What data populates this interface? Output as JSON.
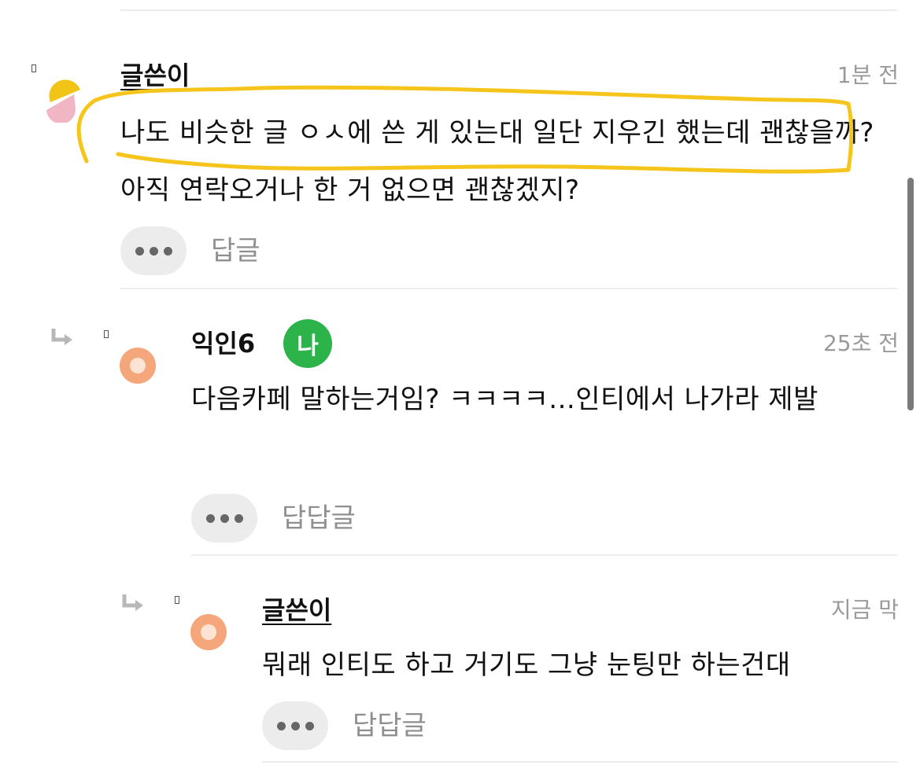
{
  "comments": [
    {
      "author": "글쓴이",
      "time": "1분 전",
      "text": "나도 비슷한 글 ㅇㅅ에 쓴 게 있는대 일단 지우긴 했는데 괜찮을까? 아직 연락오거나 한 거 없으면 괜찮겠지?",
      "reply_label": "답글"
    },
    {
      "author": "익인6",
      "badge": "나",
      "time": "25초 전",
      "text": "다음카페 말하는거임? ㅋㅋㅋㅋ...인티에서 나가라 제발",
      "reply_label": "답답글"
    },
    {
      "author": "글쓴이",
      "time": "지금 막",
      "text": "뭐래 인티도 하고 거기도 그냥 눈팅만 하는건대",
      "reply_label": "답답글"
    }
  ],
  "colors": {
    "highlight": "#f6c51b",
    "badge": "#2cb34a",
    "avatar_orange": "#f5a67a"
  },
  "icons": [
    "more-dots-icon",
    "reply-arrow-icon"
  ]
}
